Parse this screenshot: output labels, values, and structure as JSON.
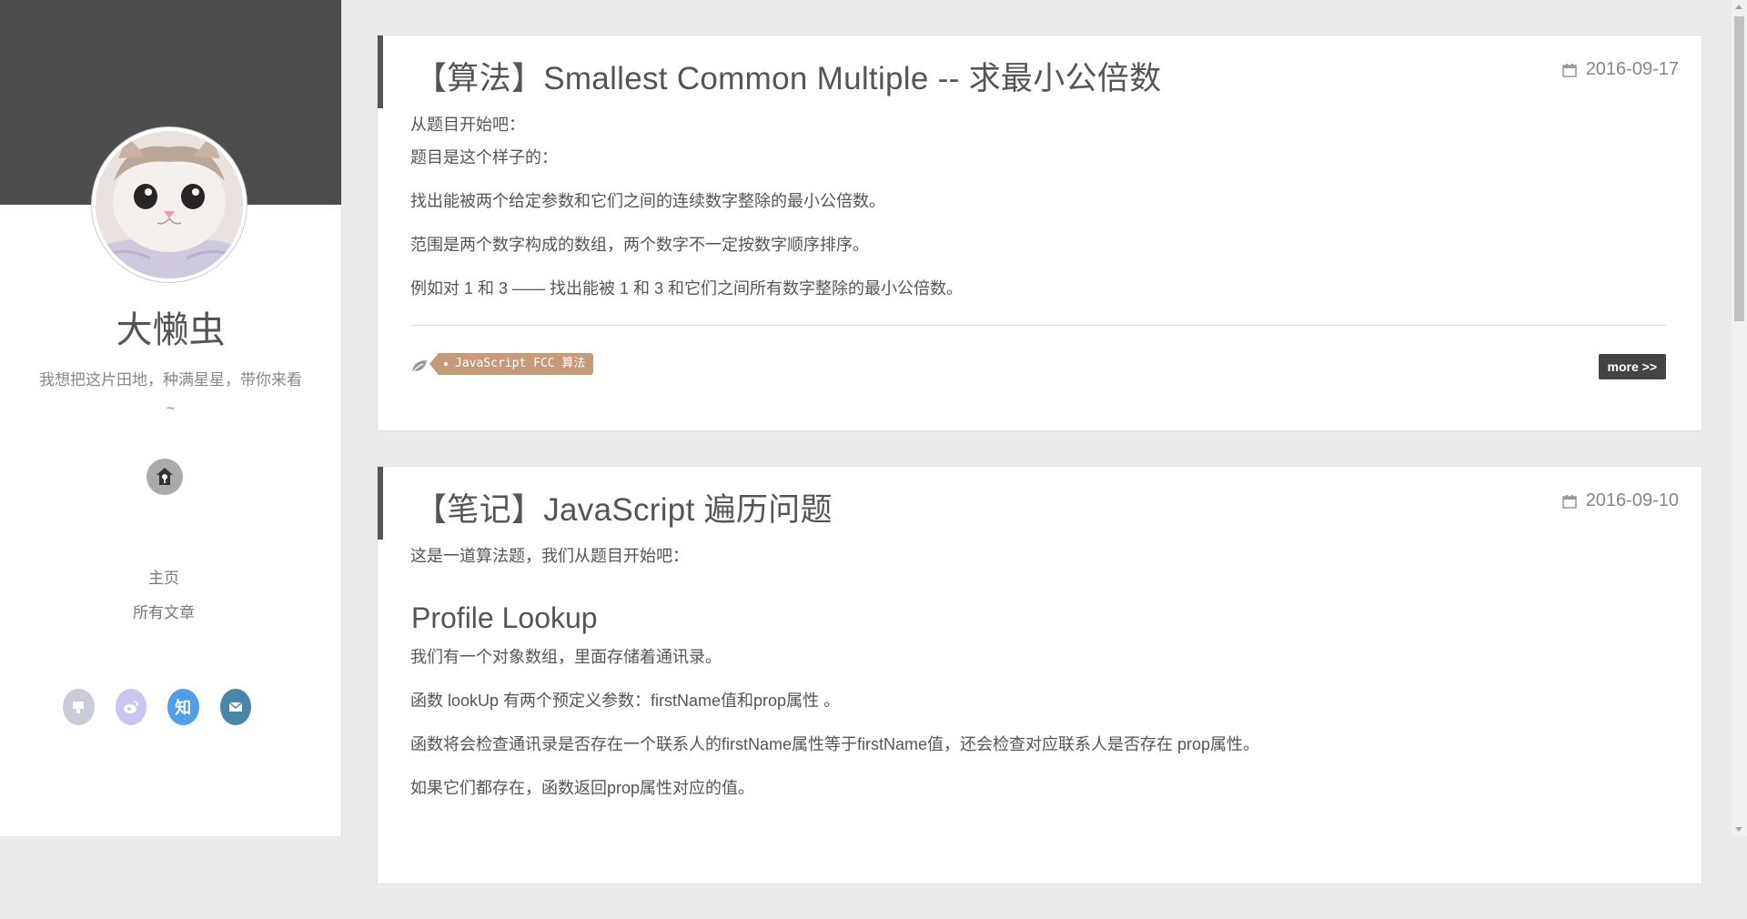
{
  "sidebar": {
    "author_name": "大懒虫",
    "author_desc": "我想把这片田地，种满星星，带你来看~",
    "nav": [
      {
        "label": "主页"
      },
      {
        "label": "所有文章"
      }
    ],
    "social_icons": [
      "github-icon",
      "weibo-icon",
      "zhihu-icon",
      "mail-icon"
    ],
    "zhihu_label": "知"
  },
  "posts": [
    {
      "title": "【算法】Smallest Common Multiple -- 求最小公倍数",
      "date": "2016-09-17",
      "paragraphs": [
        "从题目开始吧：",
        "题目是这个样子的：",
        "找出能被两个给定参数和它们之间的连续数字整除的最小公倍数。",
        "范围是两个数字构成的数组，两个数字不一定按数字顺序排序。",
        "例如对 1 和 3 —— 找出能被 1 和 3 和它们之间所有数字整除的最小公倍数。"
      ],
      "tags": "JavaScript FCC 算法",
      "more_label": "more >>"
    },
    {
      "title": "【笔记】JavaScript 遍历问题",
      "date": "2016-09-10",
      "intro": "这是一道算法题，我们从题目开始吧：",
      "heading": "Profile Lookup",
      "paragraphs": [
        "我们有一个对象数组，里面存储着通讯录。",
        "函数 lookUp 有两个预定义参数：firstName值和prop属性 。",
        "函数将会检查通讯录是否存在一个联系人的firstName属性等于firstName值，还会检查对应联系人是否存在 prop属性。",
        "如果它们都存在，函数返回prop属性对应的值。"
      ]
    }
  ],
  "colors": {
    "banner": "#4d4d4d",
    "tag": "#c59a77",
    "more_button": "#444444",
    "page_bg": "#ebebeb"
  }
}
